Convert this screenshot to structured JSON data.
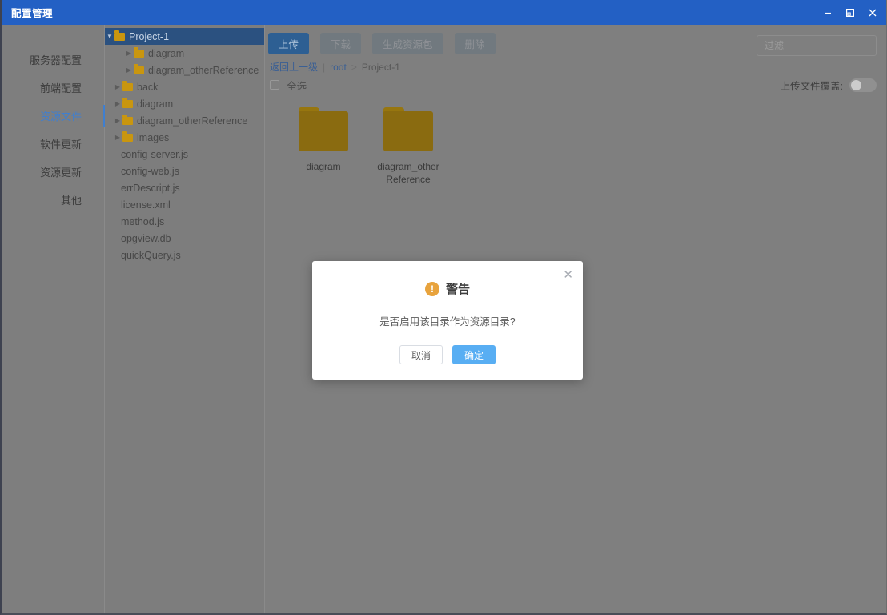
{
  "window": {
    "title": "配置管理",
    "controls": [
      {
        "name": "minimize",
        "glyph": "minimize-icon"
      },
      {
        "name": "maximize",
        "glyph": "maximize-icon"
      },
      {
        "name": "close",
        "glyph": "close-icon"
      }
    ],
    "titlebar_color": "#2360c4"
  },
  "sidebar": {
    "items": [
      {
        "label": "服务器配置",
        "active": false
      },
      {
        "label": "前端配置",
        "active": false
      },
      {
        "label": "资源文件",
        "active": true
      },
      {
        "label": "软件更新",
        "active": false
      },
      {
        "label": "资源更新",
        "active": false
      },
      {
        "label": "其他",
        "active": false
      }
    ],
    "active_color": "#3f7fd0"
  },
  "tree": {
    "nodes": [
      {
        "label": "Project-1",
        "type": "folder",
        "indent": 0,
        "caret": "expanded",
        "selected": true
      },
      {
        "label": "diagram",
        "type": "folder",
        "indent": 2,
        "caret": "collapsed",
        "selected": false
      },
      {
        "label": "diagram_otherReference",
        "type": "folder",
        "indent": 2,
        "caret": "collapsed",
        "selected": false
      },
      {
        "label": "back",
        "type": "folder",
        "indent": 1,
        "caret": "collapsed",
        "selected": false
      },
      {
        "label": "diagram",
        "type": "folder",
        "indent": 1,
        "caret": "collapsed",
        "selected": false
      },
      {
        "label": "diagram_otherReference",
        "type": "folder",
        "indent": 1,
        "caret": "collapsed",
        "selected": false
      },
      {
        "label": "images",
        "type": "folder",
        "indent": 1,
        "caret": "collapsed",
        "selected": false
      },
      {
        "label": "config-server.js",
        "type": "file",
        "indent": 1,
        "caret": "",
        "selected": false
      },
      {
        "label": "config-web.js",
        "type": "file",
        "indent": 1,
        "caret": "",
        "selected": false
      },
      {
        "label": "errDescript.js",
        "type": "file",
        "indent": 1,
        "caret": "",
        "selected": false
      },
      {
        "label": "license.xml",
        "type": "file",
        "indent": 1,
        "caret": "",
        "selected": false
      },
      {
        "label": "method.js",
        "type": "file",
        "indent": 1,
        "caret": "",
        "selected": false
      },
      {
        "label": "opgview.db",
        "type": "file",
        "indent": 1,
        "caret": "",
        "selected": false
      },
      {
        "label": "quickQuery.js",
        "type": "file",
        "indent": 1,
        "caret": "",
        "selected": false
      }
    ],
    "selected_color": "#2b5180",
    "folder_color": "#c9960f"
  },
  "toolbar": {
    "upload_label": "上传",
    "download_label": "下载",
    "build_package_label": "生成资源包",
    "delete_label": "删除",
    "filter_placeholder": "过滤",
    "filter_value": ""
  },
  "breadcrumb": {
    "back_label": "返回上一级",
    "divider": "|",
    "root_label": "root",
    "separator": ">",
    "current_label": "Project-1"
  },
  "selection_bar": {
    "select_all_label": "全选",
    "select_all_checked": false,
    "overwrite_label": "上传文件覆盖:",
    "overwrite_on": false
  },
  "files": [
    {
      "name": "diagram",
      "type": "folder"
    },
    {
      "name": "diagram_otherReference",
      "type": "folder"
    }
  ],
  "modal": {
    "title": "警告",
    "icon_glyph": "!",
    "message": "是否启用该目录作为资源目录?",
    "cancel_label": "取消",
    "confirm_label": "确定",
    "close_glyph": "✕",
    "confirm_color": "#58aef3",
    "warn_color": "#e8a33d"
  }
}
